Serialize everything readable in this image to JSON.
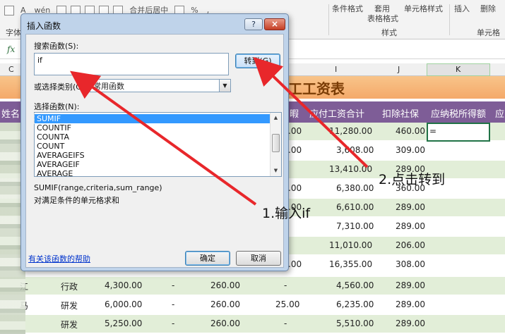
{
  "ribbon": {
    "font_size_btn": "A",
    "wen_btn": "wén",
    "merge_center": "合并后居中",
    "percent_sign": "%",
    "comma_sign": ",",
    "cond_format": "条件格式",
    "apply_table_format_1": "套用",
    "apply_table_format_2": "表格格式",
    "cell_style": "单元格样式",
    "insert": "插入",
    "delete": "删除",
    "group_font": "字体",
    "group_style": "样式",
    "group_cells": "单元格"
  },
  "formula_bar": {
    "fx": "fx"
  },
  "columns": {
    "c": "C",
    "i": "I",
    "j": "J",
    "k": "K"
  },
  "sheet": {
    "title": "工工资表",
    "headers": {
      "name": "姓名",
      "col_cut": "暇",
      "payable_total": "应付工资合计",
      "deduct_social": "扣除社保",
      "taxable_income": "应纳税所得额",
      "next_cut": "应"
    },
    "k_active_value": "=",
    "rows": [
      {
        "h": ".00",
        "i": "11,280.00",
        "j": "460.00"
      },
      {
        "h": ".00",
        "i": "3,608.00",
        "j": "309.00"
      },
      {
        "h": "",
        "i": "13,410.00",
        "j": "289.00"
      },
      {
        "h": ".00",
        "i": "6,380.00",
        "j": "360.00"
      },
      {
        "h": ".00",
        "i": "6,610.00",
        "j": "289.00"
      },
      {
        "h": "",
        "i": "7,310.00",
        "j": "289.00"
      },
      {
        "h": "",
        "i": "11,010.00",
        "j": "206.00"
      },
      {
        "h": ".00",
        "i": "16,355.00",
        "j": "308.00"
      },
      {
        "name": "江",
        "dept": "行政",
        "base": "4,300.00",
        "e": "-",
        "g": "260.00",
        "h": "-",
        "i": "4,560.00",
        "j": "289.00"
      },
      {
        "name": "马",
        "dept": "研发",
        "base": "6,000.00",
        "e": "-",
        "g": "260.00",
        "h": "25.00",
        "i": "6,235.00",
        "j": "289.00"
      },
      {
        "name": "",
        "dept": "研发",
        "base": "5,250.00",
        "e": "-",
        "g": "260.00",
        "h": "-",
        "i": "5,510.00",
        "j": "289.00"
      }
    ]
  },
  "dialog": {
    "title": "插入函数",
    "help": "?",
    "close": "×",
    "search_label": "搜索函数(S):",
    "search_value": "if",
    "goto_button": "转到(G)",
    "category_label": "或选择类别(C):",
    "category_value": "常用函数",
    "function_label": "选择函数(N):",
    "functions": [
      "SUMIF",
      "COUNTIF",
      "COUNTA",
      "COUNT",
      "AVERAGEIFS",
      "AVERAGEIF",
      "AVERAGE"
    ],
    "selected_function": "SUMIF",
    "syntax": "SUMIF(range,criteria,sum_range)",
    "description": "对满足条件的单元格求和",
    "help_link": "有关该函数的帮助",
    "ok": "确定",
    "cancel": "取消"
  },
  "annotations": {
    "step1": "1.输入if",
    "step2": "2.点击转到",
    "arrow_color": "#e8272b"
  }
}
